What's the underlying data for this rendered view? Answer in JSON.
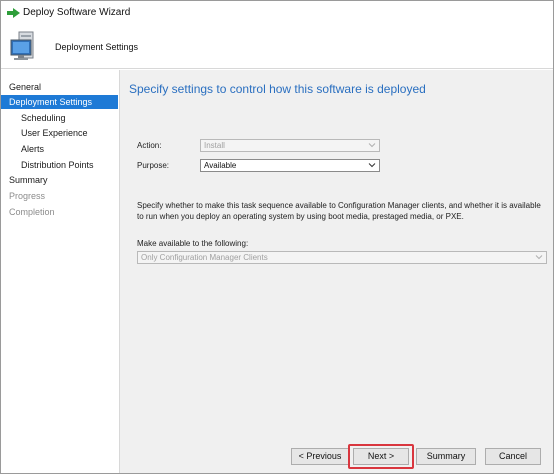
{
  "window": {
    "title": "Deploy Software Wizard"
  },
  "header": {
    "title": "Deployment Settings"
  },
  "sidebar": {
    "items": [
      {
        "label": "General",
        "state": "normal"
      },
      {
        "label": "Deployment Settings",
        "state": "active"
      },
      {
        "label": "Scheduling",
        "state": "normal"
      },
      {
        "label": "User Experience",
        "state": "normal"
      },
      {
        "label": "Alerts",
        "state": "normal"
      },
      {
        "label": "Distribution Points",
        "state": "normal"
      },
      {
        "label": "Summary",
        "state": "normal"
      },
      {
        "label": "Progress",
        "state": "disabled"
      },
      {
        "label": "Completion",
        "state": "disabled"
      }
    ]
  },
  "main": {
    "title": "Specify settings to control how this software is deployed",
    "action": {
      "label": "Action:",
      "value": "Install",
      "enabled": false
    },
    "purpose": {
      "label": "Purpose:",
      "value": "Available",
      "enabled": true
    },
    "description": "Specify whether to make this task sequence available to Configuration Manager clients, and whether it is available to run when you deploy an operating system by using boot media, prestaged media, or PXE.",
    "make_available": {
      "label": "Make available to the following:",
      "value": "Only Configuration Manager Clients",
      "enabled": false
    }
  },
  "buttons": {
    "previous": "< Previous",
    "next": "Next >",
    "summary": "Summary",
    "cancel": "Cancel"
  },
  "colors": {
    "accent": "#1e7ad6",
    "title_blue": "#2a6fc0",
    "highlight_red": "#d9363e",
    "panel_bg": "#f0f0f0"
  }
}
